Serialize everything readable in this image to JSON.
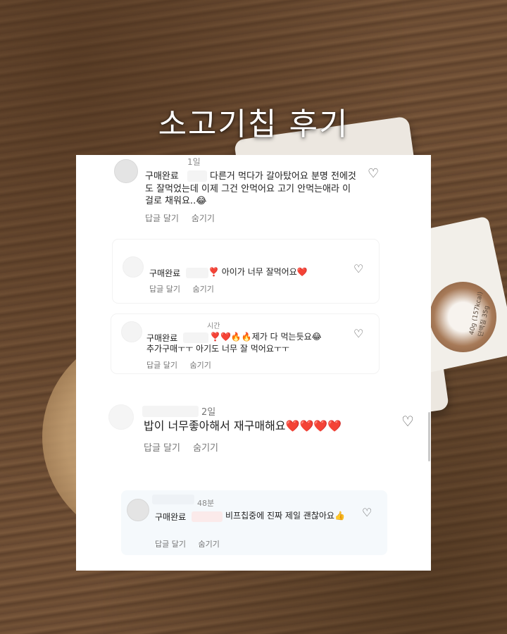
{
  "title": "소고기칩 후기",
  "comments": [
    {
      "time": "1일",
      "badge": "구매완료",
      "text": "다른거 먹다가 갈아탔어요 분명 전에것도 잘먹었는데 이제 그건 안먹어요 고기 안먹는애라 이걸로 채워요..😂",
      "reply": "답글 달기",
      "hide": "숨기기"
    },
    {
      "time": "",
      "badge": "구매완료",
      "text": "❣️ 아이가 너무 잘먹어요❤️",
      "reply": "답글 달기",
      "hide": "숨기기"
    },
    {
      "time": "시간",
      "badge": "구매완료",
      "text_line1": "❣️❤️🔥🔥제가 다 먹는듯요😂",
      "text_line2": "추가구매ㅜㅜ 아기도 너무 잘 먹어요ㅜㅜ",
      "reply": "답글 달기",
      "hide": "숨기기"
    },
    {
      "time": "2일",
      "text": "밥이 너무좋아해서 재구매해요❤️❤️❤️❤️",
      "reply": "답글 달기",
      "hide": "숨기기"
    },
    {
      "time": "48분",
      "badge": "구매완료",
      "text": "비프칩중에 진짜 제일 괜찮아요👍",
      "reply": "답글 달기",
      "hide": "숨기기"
    }
  ],
  "packet_label": "40g (157kcal) 단백질 35g",
  "colors": {
    "heart_outline": "#555555",
    "text": "#222222",
    "meta": "#8a8a8a"
  }
}
